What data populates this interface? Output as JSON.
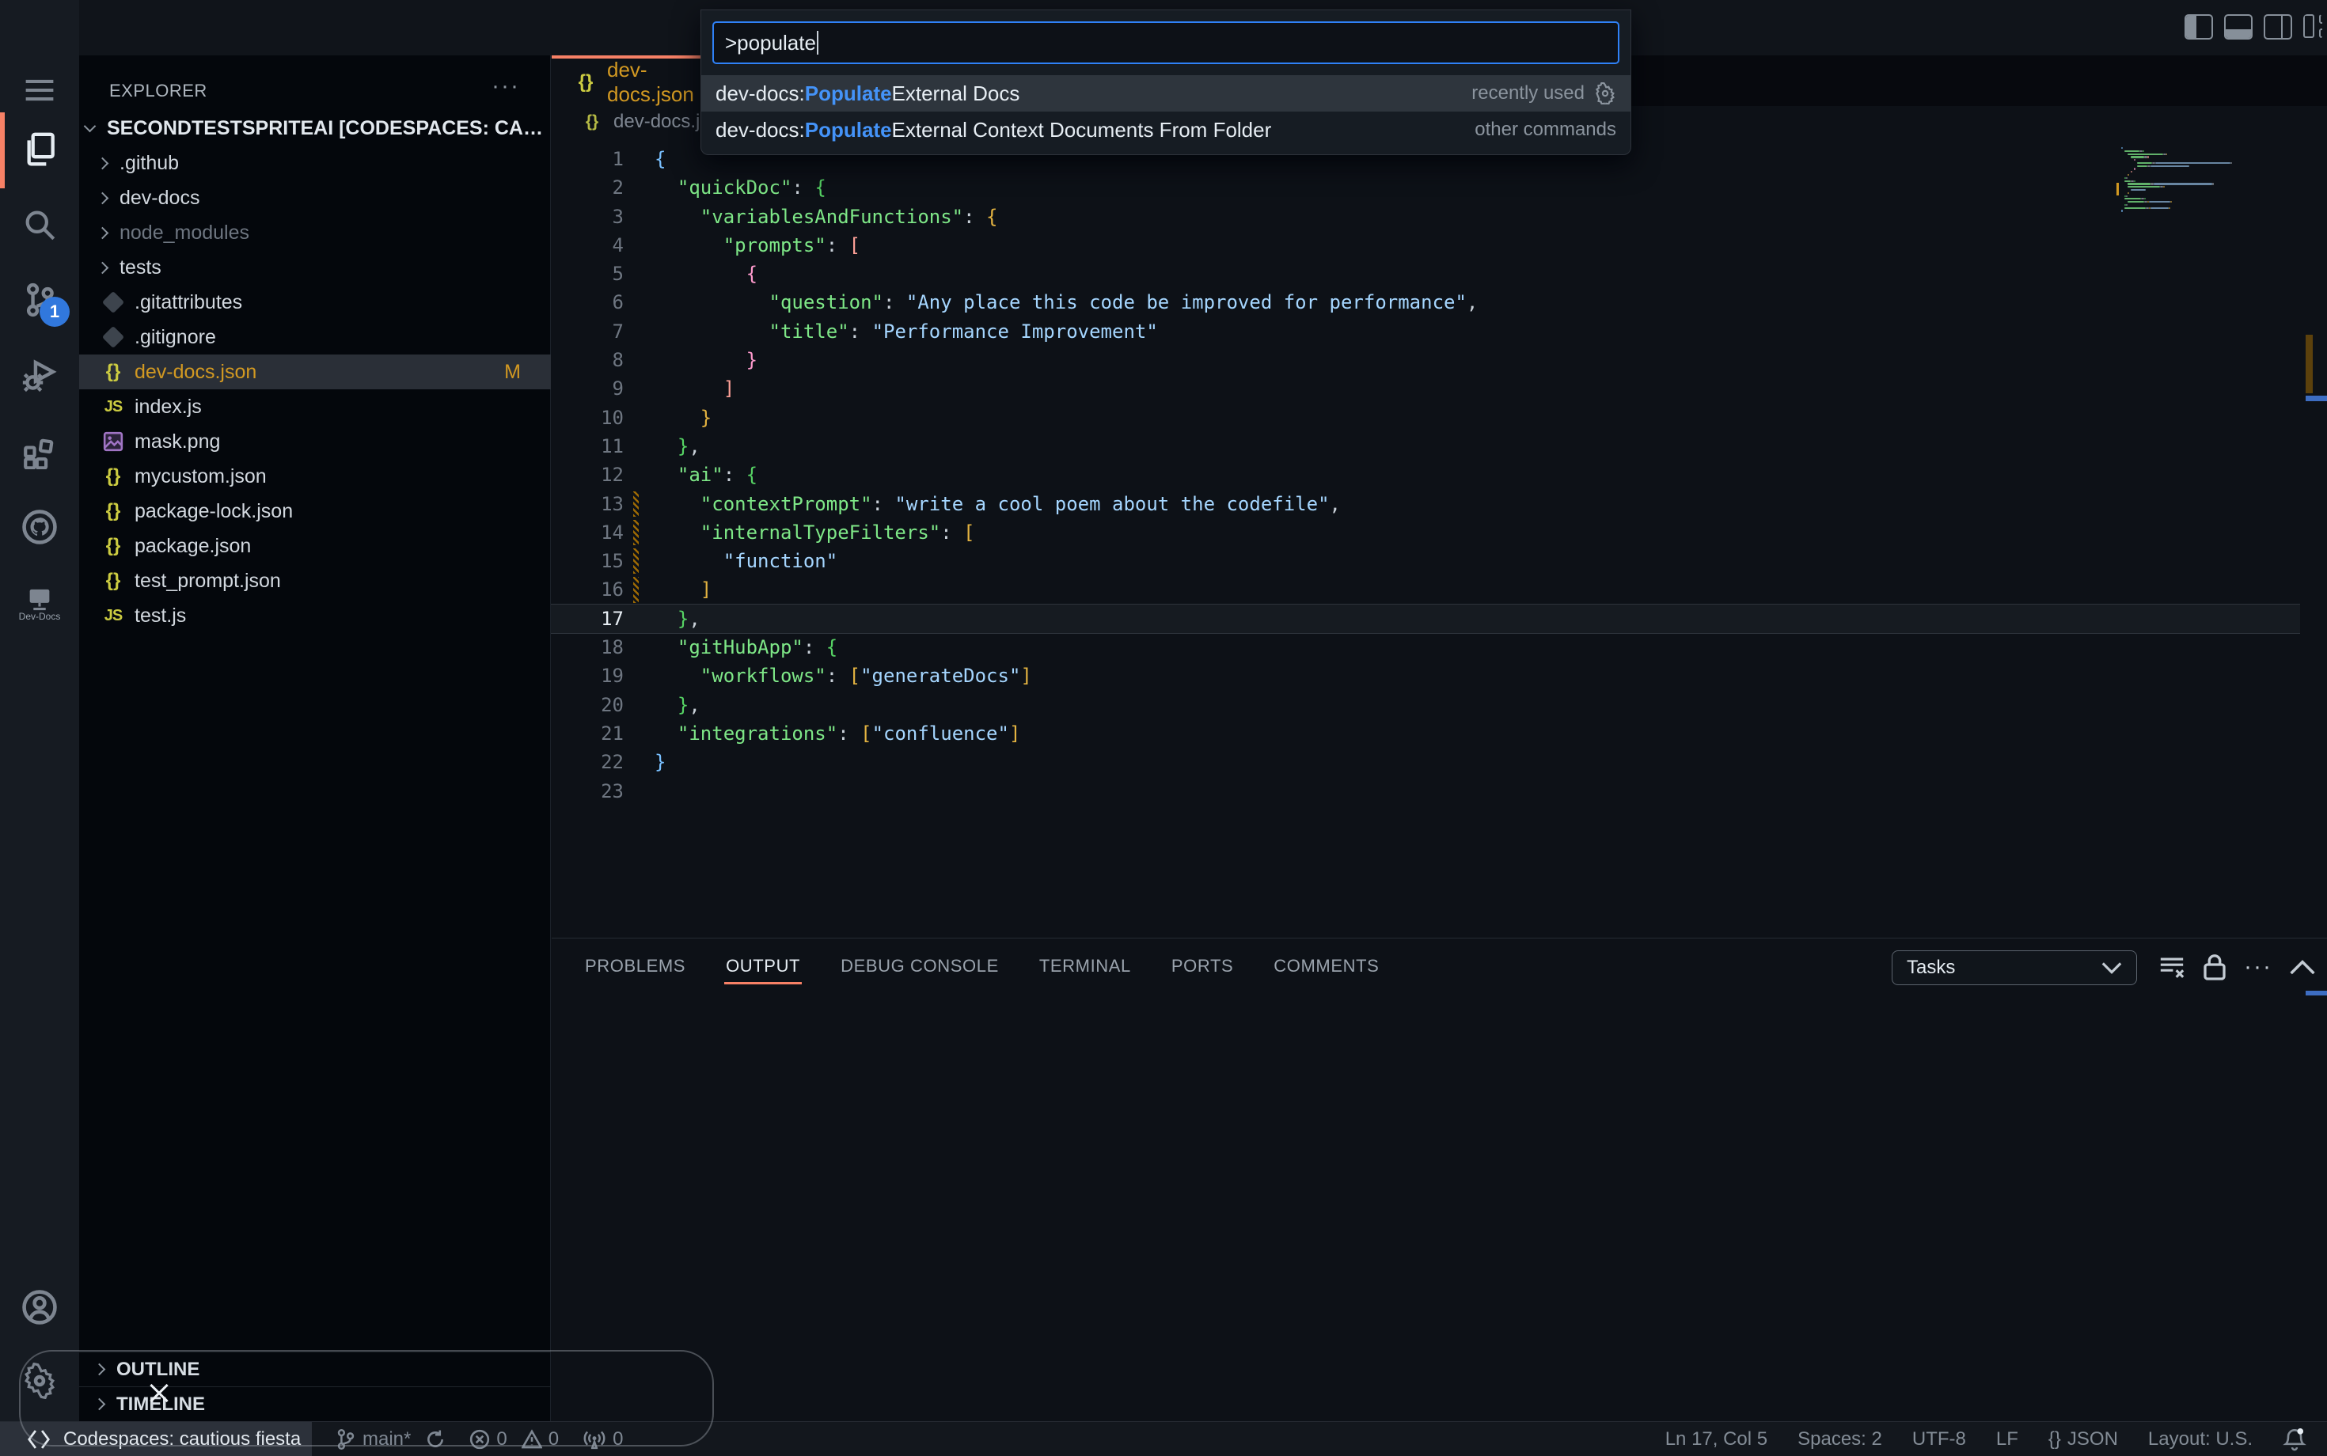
{
  "colors": {
    "accent_focus": "#2f81f7",
    "active_indicator": "#f78166",
    "modified_gold": "#d29922",
    "key_green": "#7ee787",
    "string_blue": "#a5d6ff",
    "bracket1": "#79c0ff",
    "bracket2": "#56d364",
    "bracket3": "#e3b341",
    "bracket4": "#ffa198",
    "bracket5": "#ff9bce"
  },
  "title_bar": {
    "layout_icons": [
      "toggle-primary-sidebar",
      "toggle-panel",
      "toggle-secondary-sidebar",
      "customize-layout"
    ]
  },
  "command_palette": {
    "query": ">populate",
    "results": [
      {
        "pre": "dev-docs: ",
        "match": "Populate",
        "post": " External Docs",
        "meta": "recently used",
        "gear": true,
        "selected": true
      },
      {
        "pre": "dev-docs: ",
        "match": "Populate",
        "post": " External Context Documents From Folder",
        "meta": "other commands",
        "gear": false,
        "selected": false
      }
    ]
  },
  "activity_bar": {
    "source_control_badge": "1",
    "dev_docs_label": "Dev-Docs",
    "items": [
      "menu",
      "explorer",
      "search",
      "source-control",
      "run-debug",
      "extensions",
      "github",
      "dev-docs",
      "account",
      "settings"
    ]
  },
  "explorer": {
    "header": "EXPLORER",
    "more_label": "···",
    "root": "SECONDTESTSPRITEAI [CODESPACES: CAUTIO...",
    "items": [
      {
        "label": ".github",
        "kind": "folder"
      },
      {
        "label": "dev-docs",
        "kind": "folder"
      },
      {
        "label": "node_modules",
        "kind": "folder",
        "dimmed": true
      },
      {
        "label": "tests",
        "kind": "folder"
      },
      {
        "label": ".gitattributes",
        "kind": "git"
      },
      {
        "label": ".gitignore",
        "kind": "git"
      },
      {
        "label": "dev-docs.json",
        "kind": "json",
        "selected": true,
        "badge": "M"
      },
      {
        "label": "index.js",
        "kind": "js"
      },
      {
        "label": "mask.png",
        "kind": "img"
      },
      {
        "label": "mycustom.json",
        "kind": "json"
      },
      {
        "label": "package-lock.json",
        "kind": "json"
      },
      {
        "label": "package.json",
        "kind": "json"
      },
      {
        "label": "test_prompt.json",
        "kind": "json"
      },
      {
        "label": "test.js",
        "kind": "js"
      }
    ],
    "outline": "OUTLINE",
    "timeline": "TIMELINE"
  },
  "editor": {
    "tab": {
      "icon": "{}",
      "label": "dev-docs.json"
    },
    "breadcrumb": {
      "icon": "{}",
      "label": "dev-docs.json"
    },
    "lines": [
      {
        "n": 1,
        "segs": [
          [
            "{",
            "b1"
          ]
        ]
      },
      {
        "n": 2,
        "segs": [
          [
            "  ",
            ""
          ],
          [
            "\"quickDoc\"",
            "n"
          ],
          [
            ": ",
            "p"
          ],
          [
            "{",
            "b2"
          ]
        ]
      },
      {
        "n": 3,
        "segs": [
          [
            "    ",
            ""
          ],
          [
            "\"variablesAndFunctions\"",
            "n"
          ],
          [
            ": ",
            "p"
          ],
          [
            "{",
            "b3"
          ]
        ]
      },
      {
        "n": 4,
        "segs": [
          [
            "      ",
            ""
          ],
          [
            "\"prompts\"",
            "n"
          ],
          [
            ": ",
            "p"
          ],
          [
            "[",
            "b4"
          ]
        ]
      },
      {
        "n": 5,
        "segs": [
          [
            "        ",
            ""
          ],
          [
            "{",
            "b5"
          ]
        ]
      },
      {
        "n": 6,
        "segs": [
          [
            "          ",
            ""
          ],
          [
            "\"question\"",
            "n"
          ],
          [
            ": ",
            "p"
          ],
          [
            "\"Any place this code be improved for performance\"",
            "s"
          ],
          [
            ",",
            "p"
          ]
        ]
      },
      {
        "n": 7,
        "segs": [
          [
            "          ",
            ""
          ],
          [
            "\"title\"",
            "n"
          ],
          [
            ": ",
            "p"
          ],
          [
            "\"Performance Improvement\"",
            "s"
          ]
        ]
      },
      {
        "n": 8,
        "segs": [
          [
            "        ",
            ""
          ],
          [
            "}",
            "b5"
          ]
        ]
      },
      {
        "n": 9,
        "segs": [
          [
            "      ",
            ""
          ],
          [
            "]",
            "b4"
          ]
        ]
      },
      {
        "n": 10,
        "segs": [
          [
            "    ",
            ""
          ],
          [
            "}",
            "b3"
          ]
        ]
      },
      {
        "n": 11,
        "segs": [
          [
            "  ",
            ""
          ],
          [
            "}",
            "b2"
          ],
          [
            ",",
            "p"
          ]
        ]
      },
      {
        "n": 12,
        "segs": [
          [
            "  ",
            ""
          ],
          [
            "\"ai\"",
            "n"
          ],
          [
            ": ",
            "p"
          ],
          [
            "{",
            "b2"
          ]
        ]
      },
      {
        "n": 13,
        "mod": true,
        "segs": [
          [
            "    ",
            ""
          ],
          [
            "\"contextPrompt\"",
            "n"
          ],
          [
            ": ",
            "p"
          ],
          [
            "\"write a cool poem about the codefile\"",
            "s"
          ],
          [
            ",",
            "p"
          ]
        ]
      },
      {
        "n": 14,
        "mod": true,
        "segs": [
          [
            "    ",
            ""
          ],
          [
            "\"internalTypeFilters\"",
            "n"
          ],
          [
            ": ",
            "p"
          ],
          [
            "[",
            "b3"
          ]
        ]
      },
      {
        "n": 15,
        "mod": true,
        "segs": [
          [
            "      ",
            ""
          ],
          [
            "\"function\"",
            "s"
          ]
        ]
      },
      {
        "n": 16,
        "mod": true,
        "segs": [
          [
            "    ",
            ""
          ],
          [
            "]",
            "b3"
          ]
        ]
      },
      {
        "n": 17,
        "cur": true,
        "segs": [
          [
            "  ",
            ""
          ],
          [
            "}",
            "b2"
          ],
          [
            ",",
            "p"
          ]
        ]
      },
      {
        "n": 18,
        "segs": [
          [
            "  ",
            ""
          ],
          [
            "\"gitHubApp\"",
            "n"
          ],
          [
            ": ",
            "p"
          ],
          [
            "{",
            "b2"
          ]
        ]
      },
      {
        "n": 19,
        "segs": [
          [
            "    ",
            ""
          ],
          [
            "\"workflows\"",
            "n"
          ],
          [
            ": ",
            "p"
          ],
          [
            "[",
            "b3"
          ],
          [
            "\"generateDocs\"",
            "s"
          ],
          [
            "]",
            "b3"
          ]
        ]
      },
      {
        "n": 20,
        "segs": [
          [
            "  ",
            ""
          ],
          [
            "}",
            "b2"
          ],
          [
            ",",
            "p"
          ]
        ]
      },
      {
        "n": 21,
        "segs": [
          [
            "  ",
            ""
          ],
          [
            "\"integrations\"",
            "n"
          ],
          [
            ": ",
            "p"
          ],
          [
            "[",
            "b3"
          ],
          [
            "\"confluence\"",
            "s"
          ],
          [
            "]",
            "b3"
          ]
        ]
      },
      {
        "n": 22,
        "segs": [
          [
            "}",
            "b1"
          ]
        ]
      },
      {
        "n": 23,
        "segs": []
      }
    ]
  },
  "panel": {
    "tabs": [
      "PROBLEMS",
      "OUTPUT",
      "DEBUG CONSOLE",
      "TERMINAL",
      "PORTS",
      "COMMENTS"
    ],
    "active_tab": "OUTPUT",
    "tasks_dropdown": "Tasks",
    "icons": [
      "clear-output",
      "lock",
      "more",
      "maximize-panel",
      "close-panel"
    ]
  },
  "status_bar": {
    "remote": "Codespaces: cautious fiesta",
    "branch": "main*",
    "errors": "0",
    "warnings": "0",
    "broadcast": "0",
    "right": [
      "Ln 17, Col 5",
      "Spaces: 2",
      "UTF-8",
      "LF",
      "JSON",
      "Layout: U.S."
    ]
  }
}
